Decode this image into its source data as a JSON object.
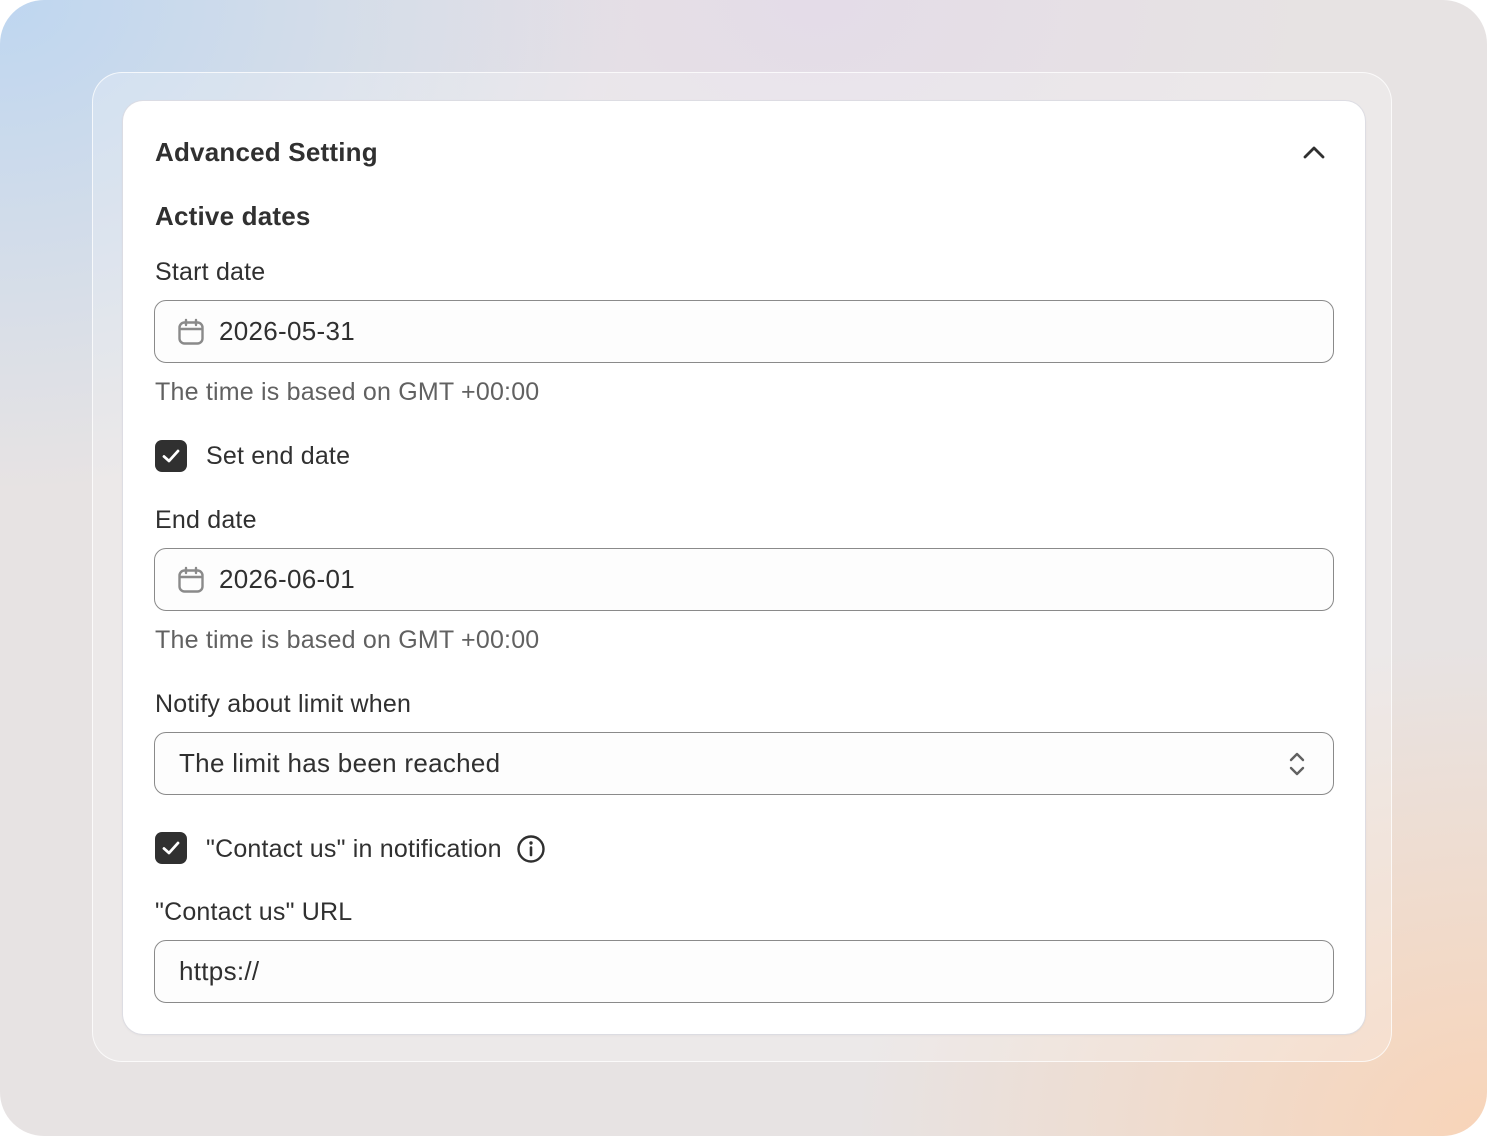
{
  "card": {
    "title": "Advanced Setting"
  },
  "active_dates": {
    "section_title": "Active dates",
    "start_date": {
      "label": "Start date",
      "value": "2026-05-31",
      "help": "The time is based on GMT +00:00"
    },
    "set_end_date": {
      "label": "Set end date",
      "checked": true
    },
    "end_date": {
      "label": "End date",
      "value": "2026-06-01",
      "help": "The time is based on GMT +00:00"
    }
  },
  "notify": {
    "label": "Notify about limit when",
    "selected": "The limit has been reached"
  },
  "contact_us": {
    "checkbox_label": "\"Contact us\" in notification",
    "checked": true,
    "url_label": "\"Contact us\" URL",
    "url_value": "https://"
  },
  "icons": {
    "collapse": "chevron-up-icon",
    "date": "calendar-icon",
    "check": "checkmark-icon",
    "select": "select-arrows-icon",
    "info": "info-icon"
  },
  "colors": {
    "checkbox_fill": "#303030",
    "text": "#303030",
    "help_text": "#616161",
    "input_border": "#8a8a8a"
  }
}
